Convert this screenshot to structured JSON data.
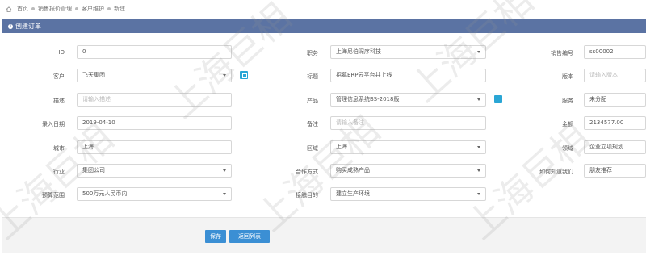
{
  "breadcrumb": [
    "首页",
    "销售报价管理",
    "客户维护",
    "新建"
  ],
  "panel": {
    "title": "创建订单"
  },
  "fields": {
    "id": {
      "label": "ID",
      "value": "0"
    },
    "employee": {
      "label": "职务",
      "value": "上海尼伯深序科技"
    },
    "sale_no": {
      "label": "销售编号",
      "value": "ss00002"
    },
    "customer": {
      "label": "客户",
      "value": "飞天集团"
    },
    "title": {
      "label": "标题",
      "value": "招募ERP云平台并上线"
    },
    "version": {
      "label": "版本",
      "placeholder": "请输入版本"
    },
    "desc": {
      "label": "描述",
      "placeholder": "请输入描述"
    },
    "product": {
      "label": "产品",
      "value": "管理信息系统BS-2018版"
    },
    "service": {
      "label": "服务",
      "value": "未分配"
    },
    "entry_date": {
      "label": "录入日期",
      "value": "2019-04-10"
    },
    "remark": {
      "label": "备注",
      "placeholder": "请输入备注"
    },
    "amount": {
      "label": "金额",
      "value": "2134577.00"
    },
    "city": {
      "label": "城市",
      "value": "上海"
    },
    "region": {
      "label": "区域",
      "value": "上海"
    },
    "domain": {
      "label": "领域",
      "value": "企业立项规划"
    },
    "industry": {
      "label": "行业",
      "value": "集团公司"
    },
    "coop": {
      "label": "合作方式",
      "value": "购买成熟产品"
    },
    "channel": {
      "label": "如何知道我们",
      "value": "朋友推荐"
    },
    "budget": {
      "label": "预算范围",
      "value": "500万元人民币内"
    },
    "deploy": {
      "label": "接触目的",
      "value": "建立生产环境"
    }
  },
  "buttons": {
    "save": "保存",
    "back": "返回列表"
  },
  "watermark": "上海巨相",
  "colors": {
    "header_bg": "#5b73a3",
    "button_bg": "#3b8fd4",
    "accent": "#2aa6d5"
  }
}
